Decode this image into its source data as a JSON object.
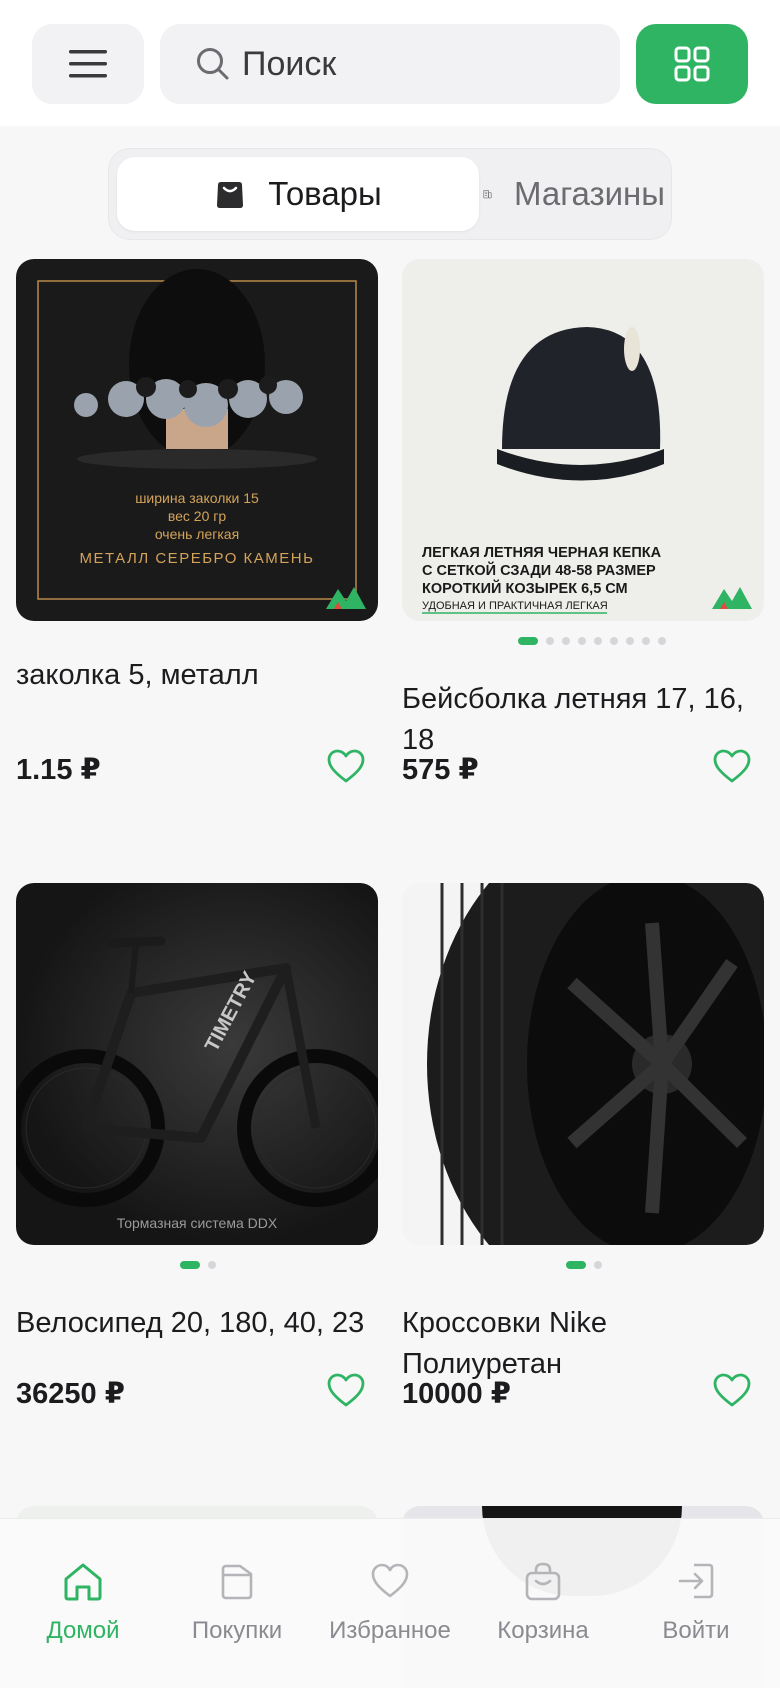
{
  "colors": {
    "accent": "#2fb463",
    "muted": "#8a8a90",
    "surface": "#f2f2f4"
  },
  "header": {
    "menu_icon": "hamburger-icon",
    "search_icon": "search-icon",
    "search_placeholder": "Поиск",
    "grid_icon": "grid-view-icon"
  },
  "tabs": [
    {
      "label": "Товары",
      "icon": "bag-icon",
      "active": true
    },
    {
      "label": "Магазины",
      "icon": "building-icon",
      "active": false
    }
  ],
  "products": [
    {
      "name": "заколка 5, металл",
      "price": "1.15 ₽",
      "image_text": [
        "ширина заколки 15",
        "вес 20 гр",
        "очень легкая",
        "МЕТАЛЛ СЕРЕБРО КАМЕНЬ"
      ],
      "image_pages": 1,
      "image_page_active": 1
    },
    {
      "name": "Бейсболка летняя 17, 16, 18",
      "price": "575 ₽",
      "image_text": [
        "ЛЕГКАЯ ЛЕТНЯЯ ЧЕРНАЯ КЕПКА",
        "С СЕТКОЙ СЗАДИ 48-58 РАЗМЕР",
        "КОРОТКИЙ КОЗЫРЕК 6,5 СМ",
        "УДОБНАЯ И ПРАКТИЧНАЯ ЛЕГКАЯ"
      ],
      "image_pages": 9,
      "image_page_active": 1
    },
    {
      "name": "Велосипед 20, 180, 40, 23",
      "price": "36250 ₽",
      "image_text": [
        "TIMETRY",
        "Тормазная система DDX"
      ],
      "image_pages": 2,
      "image_page_active": 1
    },
    {
      "name": "Кроссовки Nike Полиуретан",
      "price": "10000 ₽",
      "image_text": [],
      "image_pages": 2,
      "image_page_active": 1
    }
  ],
  "bottom_nav": [
    {
      "label": "Домой",
      "icon": "home-icon",
      "active": true
    },
    {
      "label": "Покупки",
      "icon": "purchases-icon",
      "active": false
    },
    {
      "label": "Избранное",
      "icon": "heart-icon",
      "active": false
    },
    {
      "label": "Корзина",
      "icon": "cart-icon",
      "active": false
    },
    {
      "label": "Войти",
      "icon": "login-icon",
      "active": false
    }
  ]
}
